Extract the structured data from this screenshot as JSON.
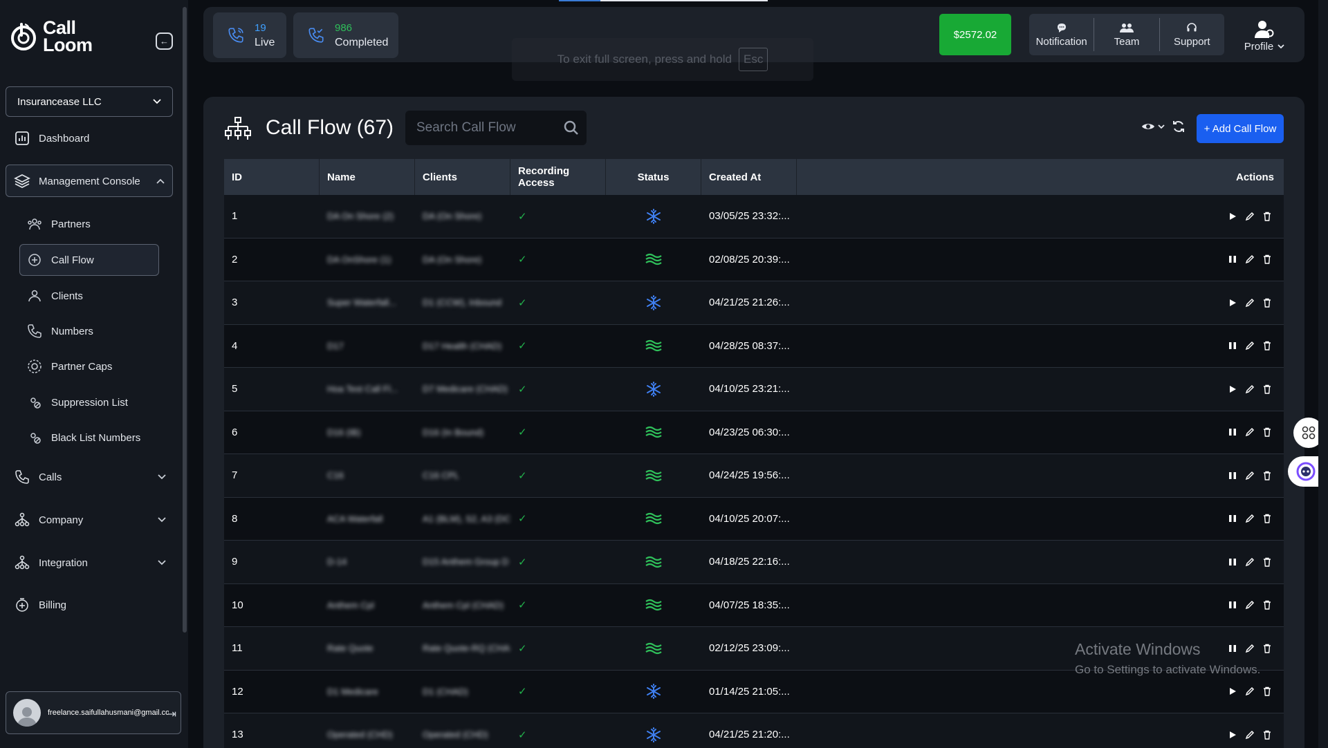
{
  "brand": {
    "line1": "Call",
    "line2": "Loom"
  },
  "org_select": {
    "value": "Insurancease LLC"
  },
  "nav": {
    "dashboard": "Dashboard",
    "management_console": "Management Console",
    "sub_items": [
      "Partners",
      "Call Flow",
      "Clients",
      "Numbers",
      "Partner Caps",
      "Suppression List",
      "Black List Numbers"
    ],
    "calls": "Calls",
    "company": "Company",
    "integration": "Integration",
    "billing": "Billing"
  },
  "user": {
    "email": "freelance.saifullahusmani@gmail.com"
  },
  "topbar": {
    "live": {
      "count": "19",
      "label": "Live"
    },
    "completed": {
      "count": "986",
      "label": "Completed"
    },
    "balance": "$2572.02",
    "notification": "Notification",
    "team": "Team",
    "support": "Support",
    "profile": "Profile"
  },
  "fullscreen_hint": {
    "text": "To exit full screen, press and hold",
    "key": "Esc"
  },
  "page": {
    "title": "Call Flow (67)",
    "search_placeholder": "Search Call Flow",
    "add_button": "+ Add Call Flow"
  },
  "table": {
    "headers": {
      "id": "ID",
      "name": "Name",
      "clients": "Clients",
      "recording": "Recording Access",
      "status": "Status",
      "created": "Created At",
      "actions": "Actions"
    },
    "rows": [
      {
        "id": "1",
        "name": "DA On Shore (2)",
        "clients": "DA (On Shore)",
        "recording": "✓",
        "status": "paused",
        "created": "03/05/25 23:32:..."
      },
      {
        "id": "2",
        "name": "DA OnShore (1)",
        "clients": "DA (On Shore)",
        "recording": "✓",
        "status": "active",
        "created": "02/08/25 20:39:..."
      },
      {
        "id": "3",
        "name": "Super Waterfall...",
        "clients": "D1 (CCW), Inbound",
        "recording": "✓",
        "status": "paused",
        "created": "04/21/25 21:26:..."
      },
      {
        "id": "4",
        "name": "D17",
        "clients": "D17 Health (CHAD)",
        "recording": "✓",
        "status": "active",
        "created": "04/28/25 08:37:..."
      },
      {
        "id": "5",
        "name": "Hoa Test Call Fl...",
        "clients": "D7 Medicare (CHAD)",
        "recording": "✓",
        "status": "paused",
        "created": "04/10/25 23:21:..."
      },
      {
        "id": "6",
        "name": "D16 (IB)",
        "clients": "D16 (In Bound)",
        "recording": "✓",
        "status": "active",
        "created": "04/23/25 06:30:..."
      },
      {
        "id": "7",
        "name": "C16",
        "clients": "C16 CPL",
        "recording": "✓",
        "status": "active",
        "created": "04/24/25 19:56:..."
      },
      {
        "id": "8",
        "name": "ACA Waterfall",
        "clients": "A1 (BLM), S2, A3 (DC",
        "recording": "✓",
        "status": "active",
        "created": "04/10/25 20:07:..."
      },
      {
        "id": "9",
        "name": "D-14",
        "clients": "D15 Anthem Group D",
        "recording": "✓",
        "status": "active",
        "created": "04/18/25 22:16:..."
      },
      {
        "id": "10",
        "name": "Anthem Cpl",
        "clients": "Anthem Cpl (CHAD)",
        "recording": "✓",
        "status": "active",
        "created": "04/07/25 18:35:..."
      },
      {
        "id": "11",
        "name": "Rate Quote",
        "clients": "Rate Quote-RQ (CHAD)",
        "recording": "✓",
        "status": "active",
        "created": "02/12/25 23:09:..."
      },
      {
        "id": "12",
        "name": "D1 Medicare",
        "clients": "D1 (CHAD)",
        "recording": "✓",
        "status": "paused",
        "created": "01/14/25 21:05:..."
      },
      {
        "id": "13",
        "name": "Operated (CHD)",
        "clients": "Operated (CHD)",
        "recording": "✓",
        "status": "paused",
        "created": "04/21/25 21:20:..."
      }
    ]
  },
  "watermark": {
    "title": "Activate Windows",
    "subtitle": "Go to Settings to activate Windows."
  },
  "colors": {
    "accent_blue": "#1a5ff0",
    "balance_green": "#18a935",
    "status_active": "#2fbf5a",
    "status_paused": "#3f7ff0",
    "check_green": "#22b24c"
  }
}
